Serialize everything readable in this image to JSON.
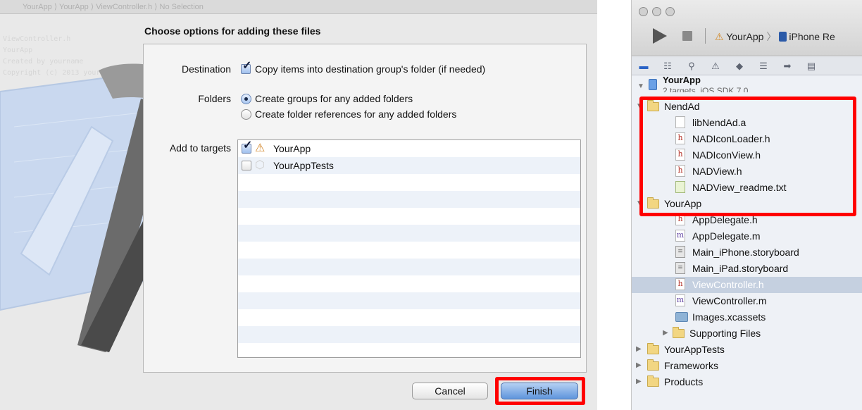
{
  "dialog": {
    "background_title": "YourApp  ⟩  YourApp  ⟩  ViewController.h  ⟩  No Selection",
    "background_code": [
      "ViewController.h",
      "YourApp",
      "",
      "Created by yourname",
      "Copyright (c) 2013 yourname."
    ],
    "title": "Choose options for adding these files",
    "destination_label": "Destination",
    "destination_option": "Copy items into destination group's folder (if needed)",
    "destination_checked": true,
    "folders_label": "Folders",
    "folders_options": [
      {
        "label": "Create groups for any added folders",
        "selected": true
      },
      {
        "label": "Create folder references for any added folders",
        "selected": false
      }
    ],
    "targets_label": "Add to targets",
    "targets": [
      {
        "label": "YourApp",
        "checked": true,
        "icon": "app-target-icon"
      },
      {
        "label": "YourAppTests",
        "checked": false,
        "icon": "test-target-icon"
      }
    ],
    "cancel_label": "Cancel",
    "finish_label": "Finish",
    "highlight_color": "#ff0000"
  },
  "xcode": {
    "scheme_app": "YourApp",
    "scheme_device": "iPhone Re",
    "project": {
      "name": "YourApp",
      "subtitle": "2 targets, iOS SDK 7.0"
    },
    "tree": [
      {
        "label": "NendAd",
        "kind": "folder",
        "level": 1,
        "open": true
      },
      {
        "label": "libNendAd.a",
        "kind": "lib",
        "level": 2
      },
      {
        "label": "NADIconLoader.h",
        "kind": "h",
        "level": 2
      },
      {
        "label": "NADIconView.h",
        "kind": "h",
        "level": 2
      },
      {
        "label": "NADView.h",
        "kind": "h",
        "level": 2
      },
      {
        "label": "NADView_readme.txt",
        "kind": "txt",
        "level": 2
      },
      {
        "label": "YourApp",
        "kind": "folder",
        "level": 1,
        "open": true
      },
      {
        "label": "AppDelegate.h",
        "kind": "h",
        "level": 2
      },
      {
        "label": "AppDelegate.m",
        "kind": "m",
        "level": 2
      },
      {
        "label": "Main_iPhone.storyboard",
        "kind": "sb",
        "level": 2
      },
      {
        "label": "Main_iPad.storyboard",
        "kind": "sb",
        "level": 2
      },
      {
        "label": "ViewController.h",
        "kind": "h",
        "level": 2,
        "selected": true
      },
      {
        "label": "ViewController.m",
        "kind": "m",
        "level": 2
      },
      {
        "label": "Images.xcassets",
        "kind": "assets",
        "level": 2
      },
      {
        "label": "Supporting Files",
        "kind": "folder",
        "level": 2,
        "open": false
      },
      {
        "label": "YourAppTests",
        "kind": "folder",
        "level": 1,
        "open": false
      },
      {
        "label": "Frameworks",
        "kind": "folder",
        "level": 1,
        "open": false
      },
      {
        "label": "Products",
        "kind": "folder",
        "level": 1,
        "open": false
      }
    ]
  }
}
